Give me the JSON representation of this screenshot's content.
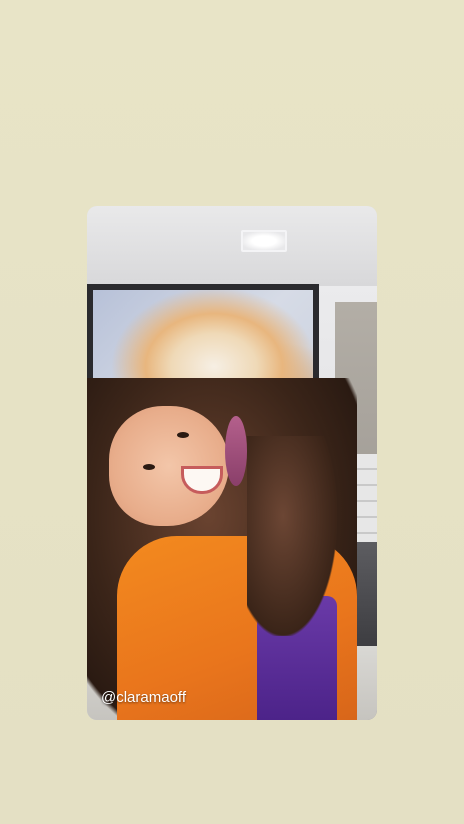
{
  "story": {
    "username": "@claramaoff"
  }
}
